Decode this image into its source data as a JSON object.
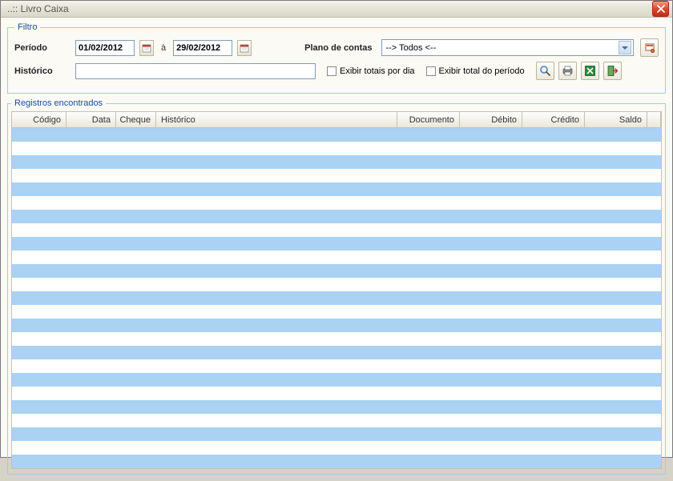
{
  "window": {
    "title": "..:: Livro Caixa"
  },
  "filter": {
    "legend": "Filtro",
    "period_label": "Período",
    "date_from": "01/02/2012",
    "date_sep": "à",
    "date_to": "29/02/2012",
    "plan_label": "Plano de contas",
    "plan_selected": "--> Todos <--",
    "history_label": "Histórico",
    "history_value": "",
    "chk_per_day": "Exibir totais por dia",
    "chk_period": "Exibir total do período"
  },
  "records": {
    "legend": "Registros encontrados",
    "columns": {
      "codigo": "Código",
      "data": "Data",
      "cheque": "Cheque",
      "historico": "Histórico",
      "documento": "Documento",
      "debito": "Débito",
      "credito": "Crédito",
      "saldo": "Saldo"
    }
  },
  "icons": {
    "search": "search-icon",
    "print": "print-icon",
    "excel": "excel-icon",
    "exit": "exit-icon",
    "config": "config-icon"
  }
}
